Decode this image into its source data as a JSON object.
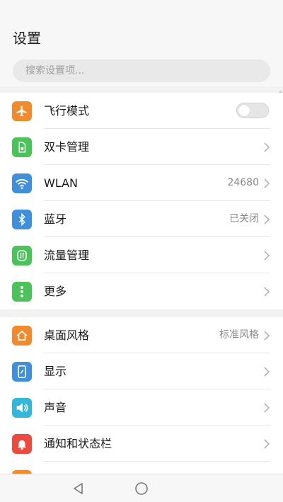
{
  "header": {
    "title": "设置",
    "search_placeholder": "搜索设置项..."
  },
  "group1": [
    {
      "label": "飞行模式",
      "icon": "airplane-icon",
      "color": "#f08a2c",
      "type": "toggle",
      "toggle_on": false
    },
    {
      "label": "双卡管理",
      "icon": "sim-card-icon",
      "color": "#4cc25a",
      "type": "chevron"
    },
    {
      "label": "WLAN",
      "icon": "wifi-icon",
      "color": "#3f8fdc",
      "type": "chevron",
      "value": "24680"
    },
    {
      "label": "蓝牙",
      "icon": "bluetooth-icon",
      "color": "#3f8fdc",
      "type": "chevron",
      "value": "已关闭"
    },
    {
      "label": "流量管理",
      "icon": "data-usage-icon",
      "color": "#4cc25a",
      "type": "chevron"
    },
    {
      "label": "更多",
      "icon": "more-icon",
      "color": "#4cc25a",
      "type": "chevron"
    }
  ],
  "group2": [
    {
      "label": "桌面风格",
      "icon": "home-style-icon",
      "color": "#f08a2c",
      "type": "chevron",
      "value": "标准风格"
    },
    {
      "label": "显示",
      "icon": "display-icon",
      "color": "#3f8fdc",
      "type": "chevron"
    },
    {
      "label": "声音",
      "icon": "sound-icon",
      "color": "#33b6d8",
      "type": "chevron"
    },
    {
      "label": "通知和状态栏",
      "icon": "notification-bell-icon",
      "color": "#ec4a3f",
      "type": "chevron"
    }
  ],
  "navbar": {
    "buttons": [
      "back-icon",
      "home-icon"
    ]
  }
}
